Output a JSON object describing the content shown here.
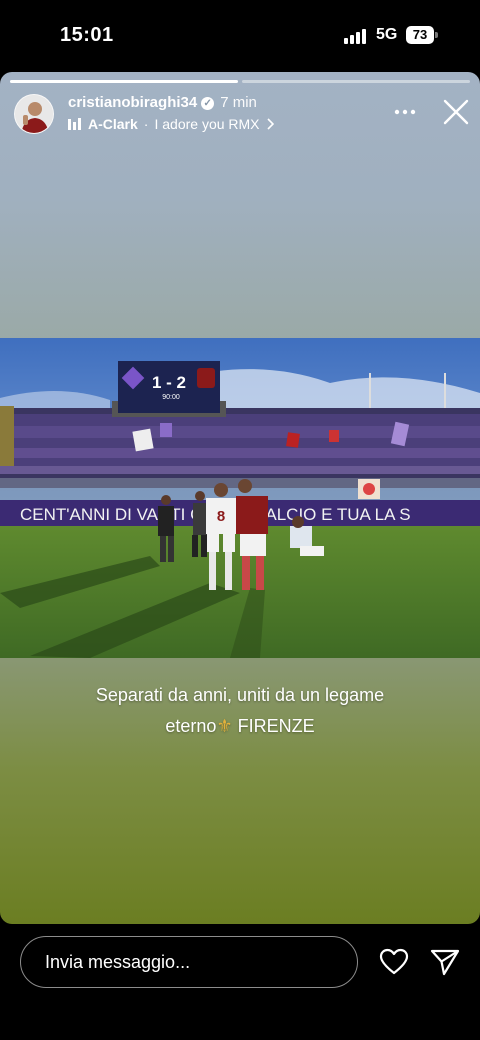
{
  "status_bar": {
    "time": "15:01",
    "network": "5G",
    "battery": "73"
  },
  "story": {
    "progress_segments": 2,
    "progress_active": 0,
    "user": {
      "username": "cristianobiraghi34",
      "time_ago": "7 min"
    },
    "music": {
      "artist": "A-Clark",
      "separator": "·",
      "track": "I adore you RMX"
    },
    "photo": {
      "scoreboard_score": "1 - 2",
      "scoreboard_time": "90:00",
      "banner_text": "CENT'ANNI DI VANTI   CL      DEL CALCIO E TUA LA S",
      "player_number": "8"
    },
    "caption": {
      "line1": "Separati da anni, uniti da un legame",
      "line2_start": "eterno",
      "line2_emoji": "⚜",
      "line2_end": "FIRENZE"
    }
  },
  "reply": {
    "placeholder": "Invia messaggio..."
  },
  "icons": {
    "verified": "verified-badge-icon",
    "music": "music-bars-icon",
    "more": "more-dots-icon",
    "close": "close-icon",
    "heart": "heart-icon",
    "send": "send-icon"
  },
  "colors": {
    "viola": "#5d3d9a",
    "granata": "#8b1a1a",
    "pitch": "#4f7a2c"
  }
}
